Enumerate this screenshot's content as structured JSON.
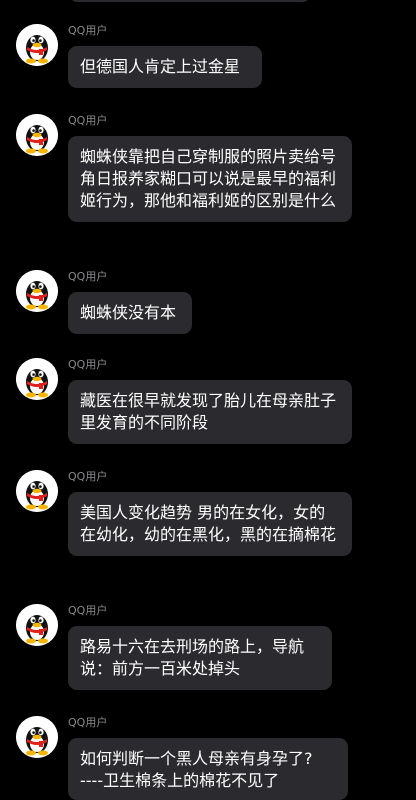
{
  "messages": [
    {
      "sender": "QQ用户",
      "text": "但德国人肯定上过金星"
    },
    {
      "sender": "QQ用户",
      "text": "蜘蛛侠靠把自己穿制服的照片卖给号角日报养家糊口可以说是最早的福利姬行为，那他和福利姬的区别是什么"
    },
    {
      "sender": "QQ用户",
      "text": "蜘蛛侠没有本"
    },
    {
      "sender": "QQ用户",
      "text": "藏医在很早就发现了胎儿在母亲肚子里发育的不同阶段"
    },
    {
      "sender": "QQ用户",
      "text": "美国人变化趋势 男的在女化，女的在幼化，幼的在黑化，黑的在摘棉花"
    },
    {
      "sender": "QQ用户",
      "text": "路易十六在去刑场的路上，导航说：前方一百米处掉头"
    },
    {
      "sender": "QQ用户",
      "text": "如何判断一个黑人母亲有身孕了?\n----卫生棉条上的棉花不见了"
    }
  ],
  "avatar_icon": "qq-penguin-icon",
  "colors": {
    "background": "#000000",
    "bubble": "#2b2b2f",
    "sender": "#8a8a8e",
    "text": "#ffffff"
  }
}
